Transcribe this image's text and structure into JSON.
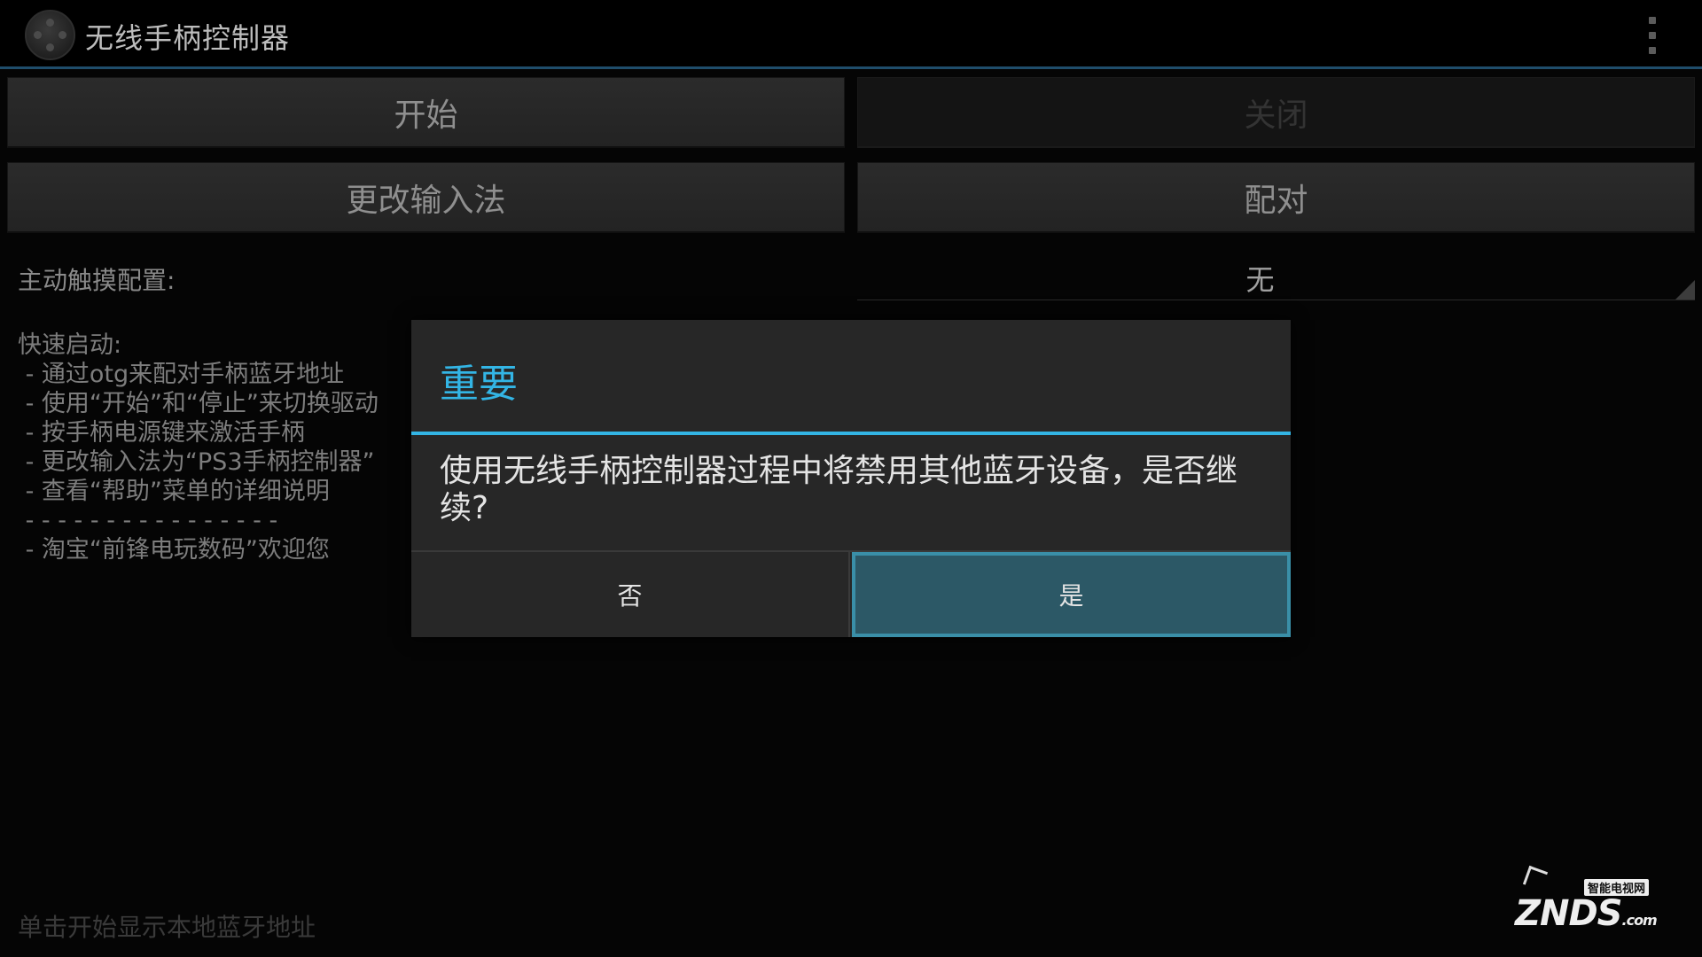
{
  "action_bar": {
    "title": "无线手柄控制器",
    "icons": {
      "app": "gamepad-icon",
      "menu": "overflow-menu-icon"
    }
  },
  "buttons": {
    "start": "开始",
    "close": "关闭",
    "change_ime": "更改输入法",
    "pair": "配对"
  },
  "touch_config": {
    "label": "主动触摸配置:",
    "value": "无"
  },
  "quick_start": {
    "heading": "快速启动:",
    "lines": [
      " - 通过otg来配对手柄蓝牙地址",
      " - 使用“开始”和“停止”来切换驱动",
      " - 按手柄电源键来激活手柄",
      " - 更改输入法为“PS3手柄控制器”",
      " - 查看“帮助”菜单的详细说明",
      " - - - - - - - - - - - - - - - -",
      " - 淘宝“前锋电玩数码”欢迎您"
    ]
  },
  "footer_hint": "单击开始显示本地蓝牙地址",
  "dialog": {
    "title": "重要",
    "message": "使用无线手柄控制器过程中将禁用其他蓝牙设备，是否继续?",
    "no": "否",
    "yes": "是"
  },
  "watermark": {
    "tag": "智能电视网",
    "logo": "ZNDS",
    "suffix": ".com"
  },
  "colors": {
    "accent": "#33b5e5",
    "dialog_bg": "#272727",
    "selected_button": "#2c5866"
  }
}
